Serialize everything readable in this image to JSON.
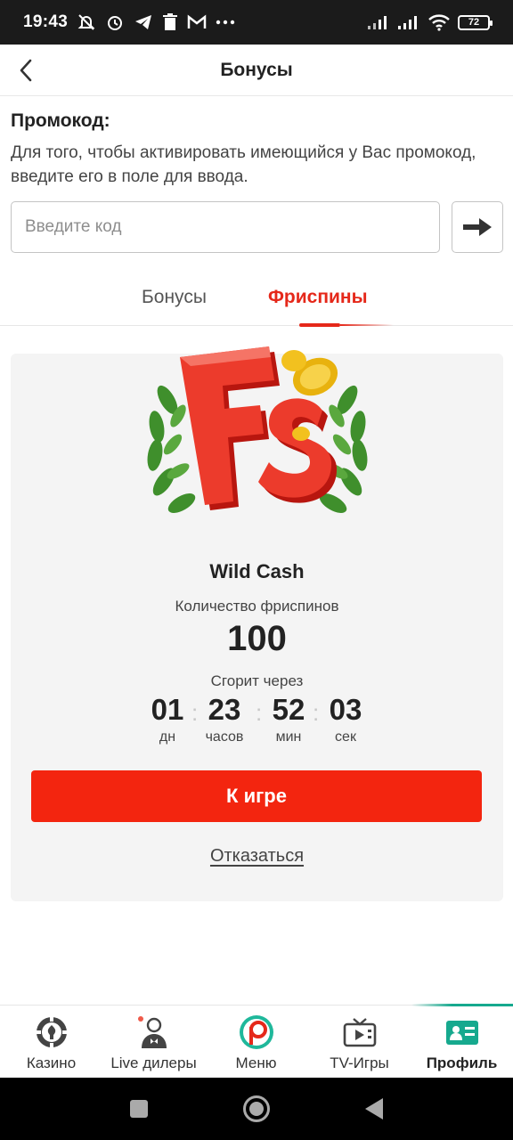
{
  "status_bar": {
    "time": "19:43",
    "battery": "72",
    "icons": [
      "mute-bell-icon",
      "alarm-icon",
      "telegram-icon",
      "trash-icon",
      "gmail-icon",
      "more-icon",
      "signal-icon",
      "signal-icon",
      "wifi-icon",
      "battery-icon"
    ]
  },
  "header": {
    "title": "Бонусы",
    "back_icon": "chevron-left-icon"
  },
  "promo": {
    "title": "Промокод:",
    "description": "Для того, чтобы активировать имеющийся у Вас промокод, введите его в поле для ввода.",
    "input_placeholder": "Введите код",
    "input_value": "",
    "submit_icon": "arrow-right-icon"
  },
  "tabs": {
    "items": [
      {
        "label": "Бонусы",
        "active": false
      },
      {
        "label": "Фриспины",
        "active": true
      }
    ],
    "accent_color": "#e5281a"
  },
  "freespin_card": {
    "logo": "FS",
    "game_name": "Wild Cash",
    "count_label": "Количество фриспинов",
    "count": "100",
    "expires_label": "Сгорит через",
    "timer": [
      {
        "value": "01",
        "unit": "дн"
      },
      {
        "value": "23",
        "unit": "часов"
      },
      {
        "value": "52",
        "unit": "мин"
      },
      {
        "value": "03",
        "unit": "сек"
      }
    ],
    "play_button": "К игре",
    "decline_link": "Отказаться",
    "button_color": "#f3250f"
  },
  "bottom_nav": {
    "items": [
      {
        "label": "Казино",
        "icon": "casino-chip-icon",
        "active": false
      },
      {
        "label": "Live дилеры",
        "icon": "live-dealer-icon",
        "active": false
      },
      {
        "label": "Меню",
        "icon": "menu-logo-icon",
        "active": false
      },
      {
        "label": "TV-Игры",
        "icon": "tv-icon",
        "active": false
      },
      {
        "label": "Профиль",
        "icon": "profile-card-icon",
        "active": true
      }
    ],
    "active_color": "#16a98e"
  },
  "system_nav": [
    "square-icon",
    "circle-home-icon",
    "triangle-back-icon"
  ]
}
